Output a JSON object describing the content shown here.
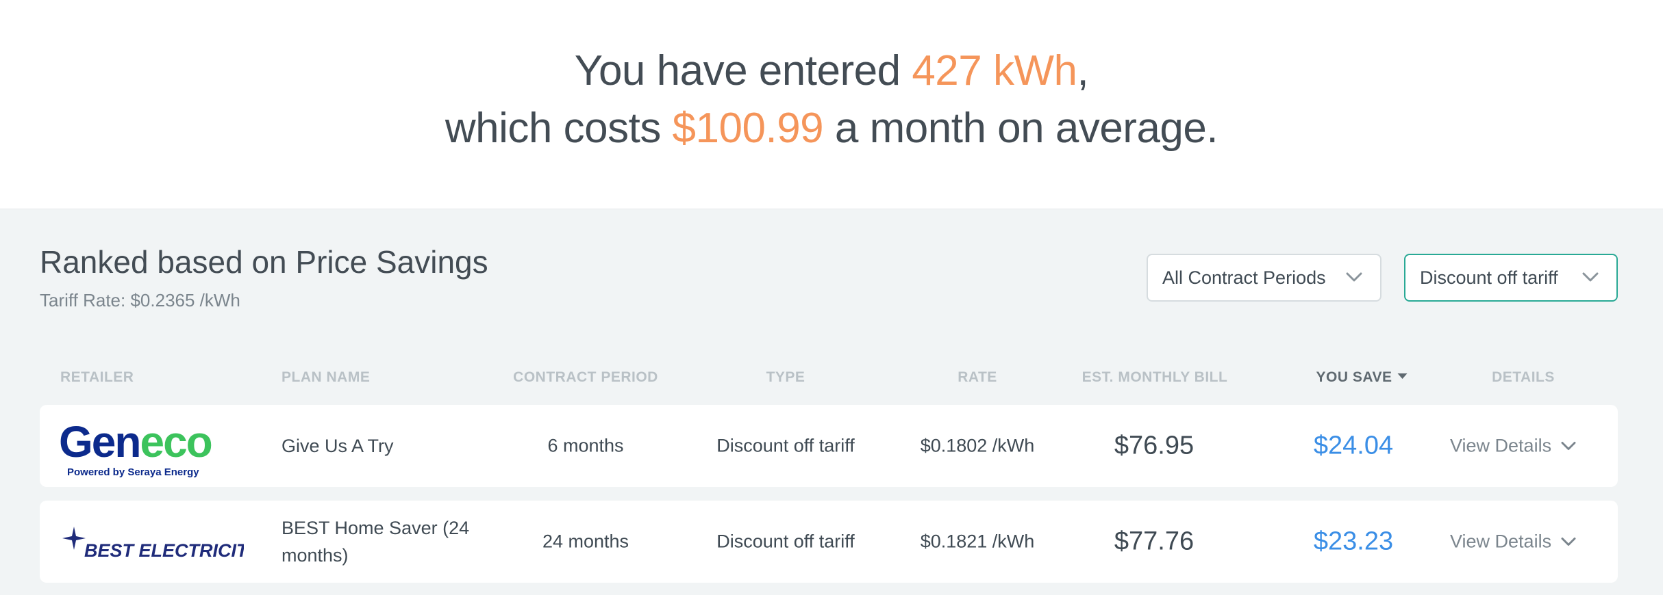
{
  "hero": {
    "line1_prefix": "You have entered ",
    "usage": "427 kWh",
    "line1_suffix": ",",
    "line2_prefix": "which costs ",
    "cost": "$100.99",
    "line2_suffix": " a month on average."
  },
  "ranking": {
    "title": "Ranked based on Price Savings",
    "tariff_rate": "Tariff Rate: $0.2365 /kWh"
  },
  "filters": {
    "contract_period": "All Contract Periods",
    "plan_type": "Discount off tariff"
  },
  "table": {
    "columns": [
      "RETAILER",
      "PLAN NAME",
      "CONTRACT PERIOD",
      "TYPE",
      "RATE",
      "EST. MONTHLY BILL",
      "YOU SAVE",
      "DETAILS"
    ],
    "sorted_column": "YOU SAVE",
    "rows": [
      {
        "retailer_logo": {
          "name": "Geneco",
          "part1": "G",
          "part2": "en",
          "part3": "eco",
          "tagline": "Powered by Seraya Energy"
        },
        "plan_name": "Give Us A Try",
        "contract_period": "6 months",
        "type": "Discount off tariff",
        "rate": "$0.1802 /kWh",
        "monthly_bill": "$76.95",
        "you_save": "$24.04",
        "details": "View Details"
      },
      {
        "retailer_logo": {
          "name": "BEST ELECTRICITY"
        },
        "plan_name": "BEST Home Saver (24 months)",
        "contract_period": "24 months",
        "type": "Discount off tariff",
        "rate": "$0.1821 /kWh",
        "monthly_bill": "$77.76",
        "you_save": "$23.23",
        "details": "View Details"
      }
    ]
  },
  "colors": {
    "highlight": "#f5955a",
    "savings": "#3a8ee6",
    "accent_border": "#29a995",
    "geneco_blue": "#0c2a8c",
    "geneco_green": "#3cc35c",
    "best_navy": "#1f2b7a"
  }
}
